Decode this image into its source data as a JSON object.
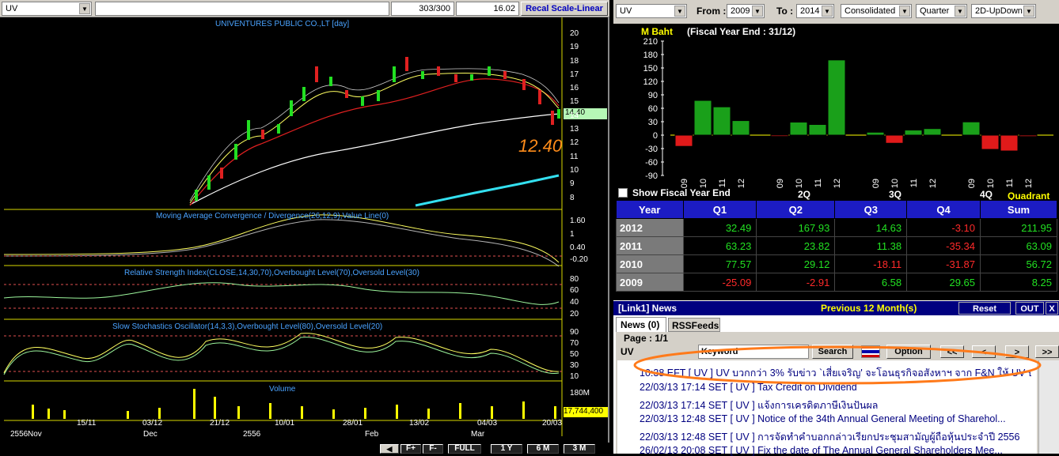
{
  "toolbar": {
    "symbol": "UV",
    "count": "303/300",
    "price": "16.02",
    "scale_button": "Recal Scale-Linear"
  },
  "chart": {
    "title": "UNIVENTURES PUBLIC CO.,LT [day]",
    "current_price_tag": "14.40",
    "big_price": "12.40",
    "price_axis": [
      "20",
      "19",
      "18",
      "17",
      "16",
      "15",
      "14",
      "13",
      "12",
      "11",
      "10",
      "9",
      "8"
    ],
    "macd_label": "Moving Average Convergence / Divergence(26,12,9),Value Line(0)",
    "macd_axis": [
      "1.60",
      "1",
      "0.40",
      "-0.20"
    ],
    "rsi_label": "Relative Strength Index(CLOSE,14,30,70),Overbought Level(70),Oversold Level(30)",
    "rsi_axis": [
      "80",
      "60",
      "40",
      "20"
    ],
    "stoch_label": "Slow Stochastics Oscillator(14,3,3),Overbought Level(80),Oversold Level(20)",
    "stoch_axis": [
      "90",
      "70",
      "50",
      "30",
      "10"
    ],
    "volume_label": "Volume",
    "volume_axis": "180M",
    "volume_tag": "17,744,400",
    "dates_row1": [
      "15/11",
      "03/12",
      "21/12",
      "10/01",
      "28/01",
      "13/02",
      "04/03",
      "20/03"
    ],
    "dates_row2": [
      "2556",
      "Nov",
      "Dec",
      "2556",
      "Feb",
      "Mar"
    ],
    "bottom_buttons": [
      "F+",
      "F-",
      "FULL",
      "1 Y",
      "6 M",
      "3 M"
    ]
  },
  "financial_toolbar": {
    "symbol": "UV",
    "from_label": "From :",
    "from_value": "2009",
    "to_label": "To :",
    "to_value": "2014",
    "type": "Consolidated",
    "period": "Quarter",
    "chart_type": "2D-UpDown"
  },
  "bar_chart": {
    "unit": "M Baht",
    "fiscal": "(Fiscal Year End : 31/12)",
    "y_ticks": [
      "210",
      "180",
      "150",
      "120",
      "90",
      "60",
      "30",
      "0",
      "-30",
      "-60",
      "-90"
    ],
    "show_fiscal_label": "Show Fiscal Year End",
    "quarter_labels": [
      "2Q",
      "3Q",
      "4Q"
    ],
    "quadrant_label": "Quadrant",
    "x_tick_labels": [
      "09",
      "10",
      "11",
      "12"
    ]
  },
  "chart_data": {
    "type": "bar",
    "categories": [
      "Q1-09",
      "Q1-10",
      "Q1-11",
      "Q1-12",
      "Q2-09",
      "Q2-10",
      "Q2-11",
      "Q2-12",
      "Q3-09",
      "Q3-10",
      "Q3-11",
      "Q3-12",
      "Q4-09",
      "Q4-10",
      "Q4-11",
      "Q4-12"
    ],
    "values": [
      -25.09,
      77.57,
      63.23,
      32.49,
      -2.91,
      29.12,
      23.82,
      167.93,
      6.58,
      -18.11,
      11.38,
      14.63,
      29.65,
      -31.87,
      -35.34,
      -3.1
    ],
    "ylim": [
      -90,
      210
    ],
    "colors": {
      "positive": "#1aa01a",
      "negative": "#e01a1a"
    }
  },
  "fin_table": {
    "headers": [
      "Year",
      "Q1",
      "Q2",
      "Q3",
      "Q4",
      "Sum"
    ],
    "rows": [
      {
        "year": "2012",
        "q1": "32.49",
        "q2": "167.93",
        "q3": "14.63",
        "q4": "-3.10",
        "sum": "211.95"
      },
      {
        "year": "2011",
        "q1": "63.23",
        "q2": "23.82",
        "q3": "11.38",
        "q4": "-35.34",
        "sum": "63.09"
      },
      {
        "year": "2010",
        "q1": "77.57",
        "q2": "29.12",
        "q3": "-18.11",
        "q4": "-31.87",
        "sum": "56.72"
      },
      {
        "year": "2009",
        "q1": "-25.09",
        "q2": "-2.91",
        "q3": "6.58",
        "q4": "29.65",
        "sum": "8.25"
      }
    ]
  },
  "news": {
    "title": "[Link1] News",
    "previous": "Previous 12 Month(s)",
    "reset": "Reset",
    "out": "OUT",
    "close": "X",
    "tab_news": "News (0)",
    "tab_rss": "RSSFeeds",
    "page": "Page : 1/1",
    "symbol": "UV",
    "keyword_label": "Keyword",
    "search": "Search",
    "option": "Option",
    "nav": [
      "<<",
      "<",
      ">",
      ">>"
    ],
    "items": [
      "10:38  EFT  [ UV ]  UV บวกกว่า 3% รับข่าว `เสี่ยเจริญ' จะโอนธุรกิจอสังหาฯ จาก F&N ให้ UV บริห...",
      "22/03/13 17:14  SET  [ UV ]  Tax Credit on Dividend",
      "22/03/13 17:14  SET  [ UV ]  แจ้งการเครดิตภาษีเงินปันผล",
      "22/03/13 12:48  SET  [ UV ]  Notice of the 34th Annual General Meeting of Sharehol...",
      "22/03/13 12:48  SET  [ UV ]  การจัดทำคำบอกกล่าวเรียกประชุมสามัญผู้ถือหุ้นประจำปี 2556",
      "26/02/13 20:08  SET  [ UV ]  Fix the date of The Annual General Shareholders Mee..."
    ]
  }
}
